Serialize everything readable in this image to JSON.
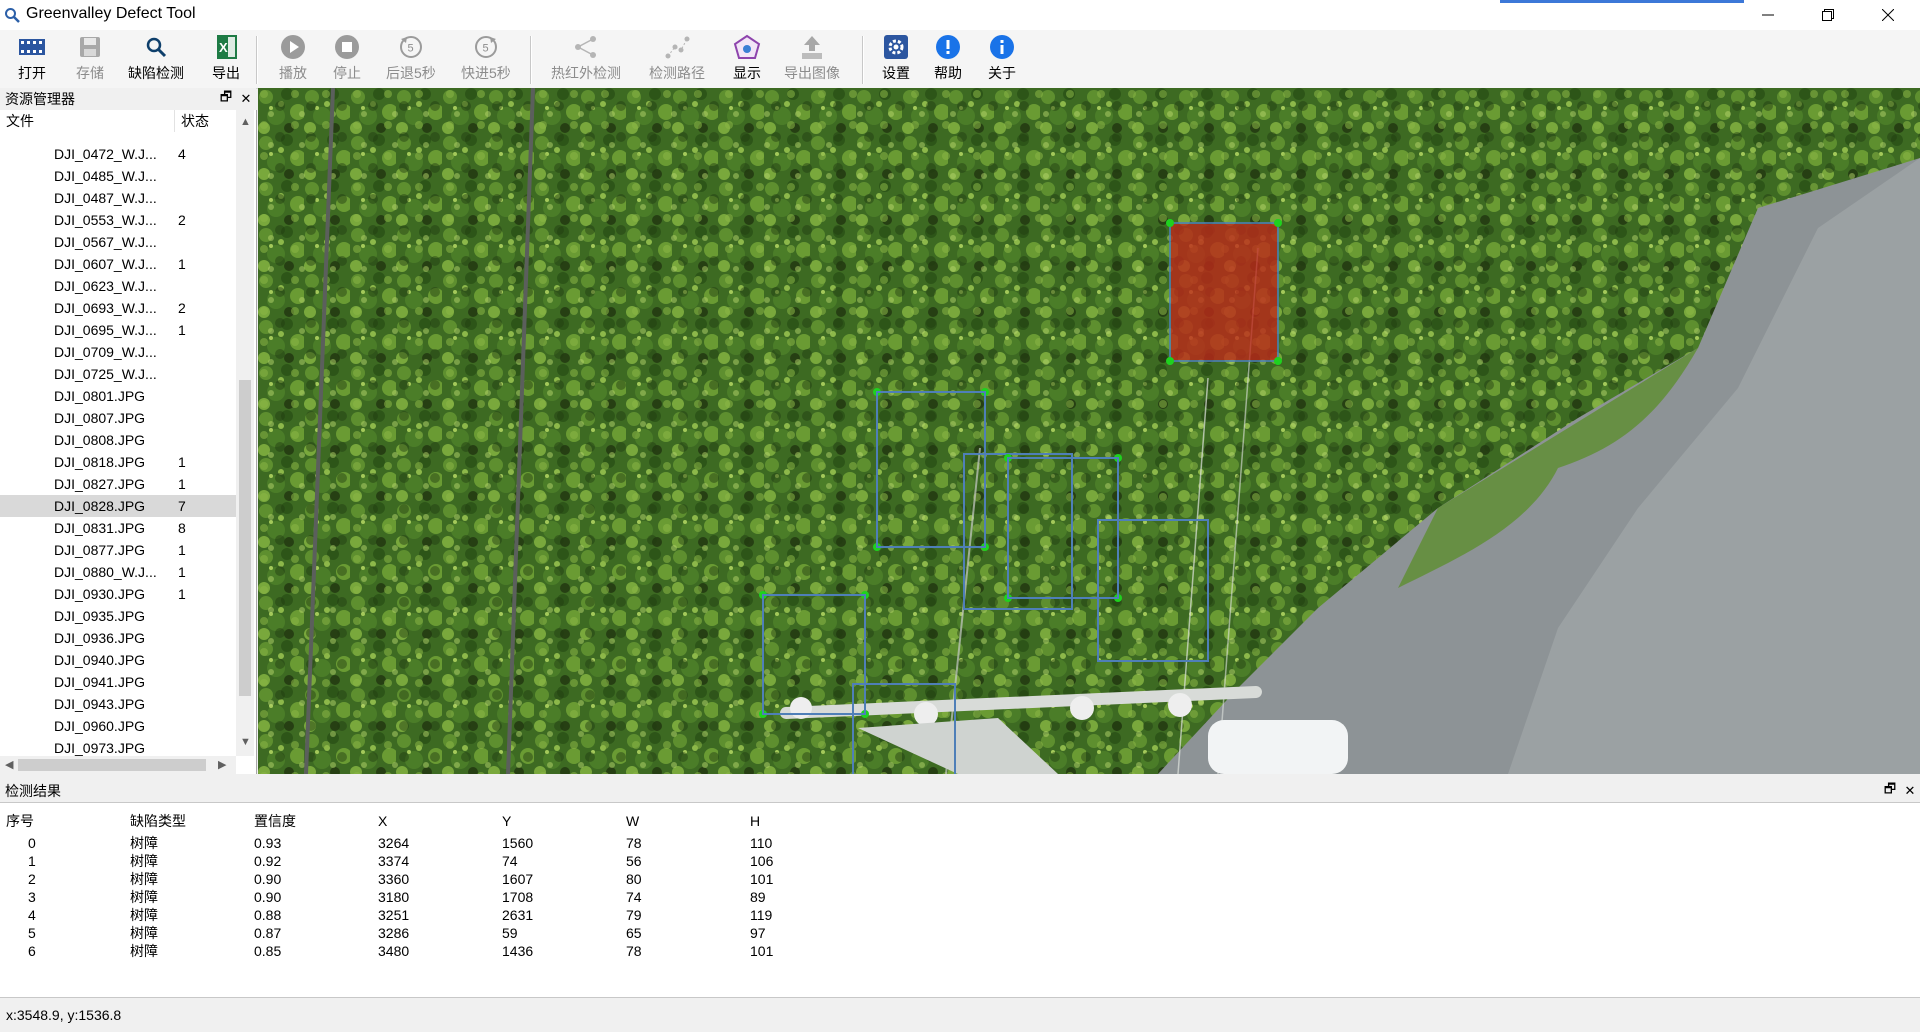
{
  "app": {
    "title": "Greenvalley Defect Tool"
  },
  "toolbar": {
    "open": "打开",
    "save": "存储",
    "detect": "缺陷检测",
    "export": "导出",
    "play": "播放",
    "stop": "停止",
    "back5": "后退5秒",
    "forward5": "快进5秒",
    "infrared": "热红外检测",
    "path": "检测路径",
    "display": "显示",
    "export_image": "导出图像",
    "settings": "设置",
    "help": "帮助",
    "about": "关于",
    "back5_digit": "5",
    "forward5_digit": "5"
  },
  "explorer": {
    "title": "资源管理器",
    "col_file": "文件",
    "col_status": "状态",
    "selected_index": 16,
    "files": [
      {
        "name": "DJI_0472_W.J...",
        "status": "4"
      },
      {
        "name": "DJI_0485_W.J...",
        "status": ""
      },
      {
        "name": "DJI_0487_W.J...",
        "status": ""
      },
      {
        "name": "DJI_0553_W.J...",
        "status": "2"
      },
      {
        "name": "DJI_0567_W.J...",
        "status": ""
      },
      {
        "name": "DJI_0607_W.J...",
        "status": "1"
      },
      {
        "name": "DJI_0623_W.J...",
        "status": ""
      },
      {
        "name": "DJI_0693_W.J...",
        "status": "2"
      },
      {
        "name": "DJI_0695_W.J...",
        "status": "1"
      },
      {
        "name": "DJI_0709_W.J...",
        "status": ""
      },
      {
        "name": "DJI_0725_W.J...",
        "status": ""
      },
      {
        "name": "DJI_0801.JPG",
        "status": ""
      },
      {
        "name": "DJI_0807.JPG",
        "status": ""
      },
      {
        "name": "DJI_0808.JPG",
        "status": ""
      },
      {
        "name": "DJI_0818.JPG",
        "status": "1"
      },
      {
        "name": "DJI_0827.JPG",
        "status": "1"
      },
      {
        "name": "DJI_0828.JPG",
        "status": "7"
      },
      {
        "name": "DJI_0831.JPG",
        "status": "8"
      },
      {
        "name": "DJI_0877.JPG",
        "status": "1"
      },
      {
        "name": "DJI_0880_W.J...",
        "status": "1"
      },
      {
        "name": "DJI_0930.JPG",
        "status": "1"
      },
      {
        "name": "DJI_0935.JPG",
        "status": ""
      },
      {
        "name": "DJI_0936.JPG",
        "status": ""
      },
      {
        "name": "DJI_0940.JPG",
        "status": ""
      },
      {
        "name": "DJI_0941.JPG",
        "status": ""
      },
      {
        "name": "DJI_0943.JPG",
        "status": ""
      },
      {
        "name": "DJI_0960.JPG",
        "status": ""
      },
      {
        "name": "DJI_0973.JPG",
        "status": ""
      }
    ]
  },
  "results": {
    "title": "检测结果",
    "columns": [
      "序号",
      "缺陷类型",
      "置信度",
      "X",
      "Y",
      "W",
      "H"
    ],
    "rows": [
      [
        "0",
        "树障",
        "0.93",
        "3264",
        "1560",
        "78",
        "110"
      ],
      [
        "1",
        "树障",
        "0.92",
        "3374",
        "74",
        "56",
        "106"
      ],
      [
        "2",
        "树障",
        "0.90",
        "3360",
        "1607",
        "80",
        "101"
      ],
      [
        "3",
        "树障",
        "0.90",
        "3180",
        "1708",
        "74",
        "89"
      ],
      [
        "4",
        "树障",
        "0.88",
        "3251",
        "2631",
        "79",
        "119"
      ],
      [
        "5",
        "树障",
        "0.87",
        "3286",
        "59",
        "65",
        "97"
      ],
      [
        "6",
        "树障",
        "0.85",
        "3480",
        "1436",
        "78",
        "101"
      ]
    ]
  },
  "status": {
    "coords": "x:3548.9, y:1536.8"
  },
  "colors": {
    "defect_box": "#4f7fb8",
    "selected_box": "#c0281a",
    "handle": "#1fd11f",
    "accent": "#1a73e8"
  }
}
